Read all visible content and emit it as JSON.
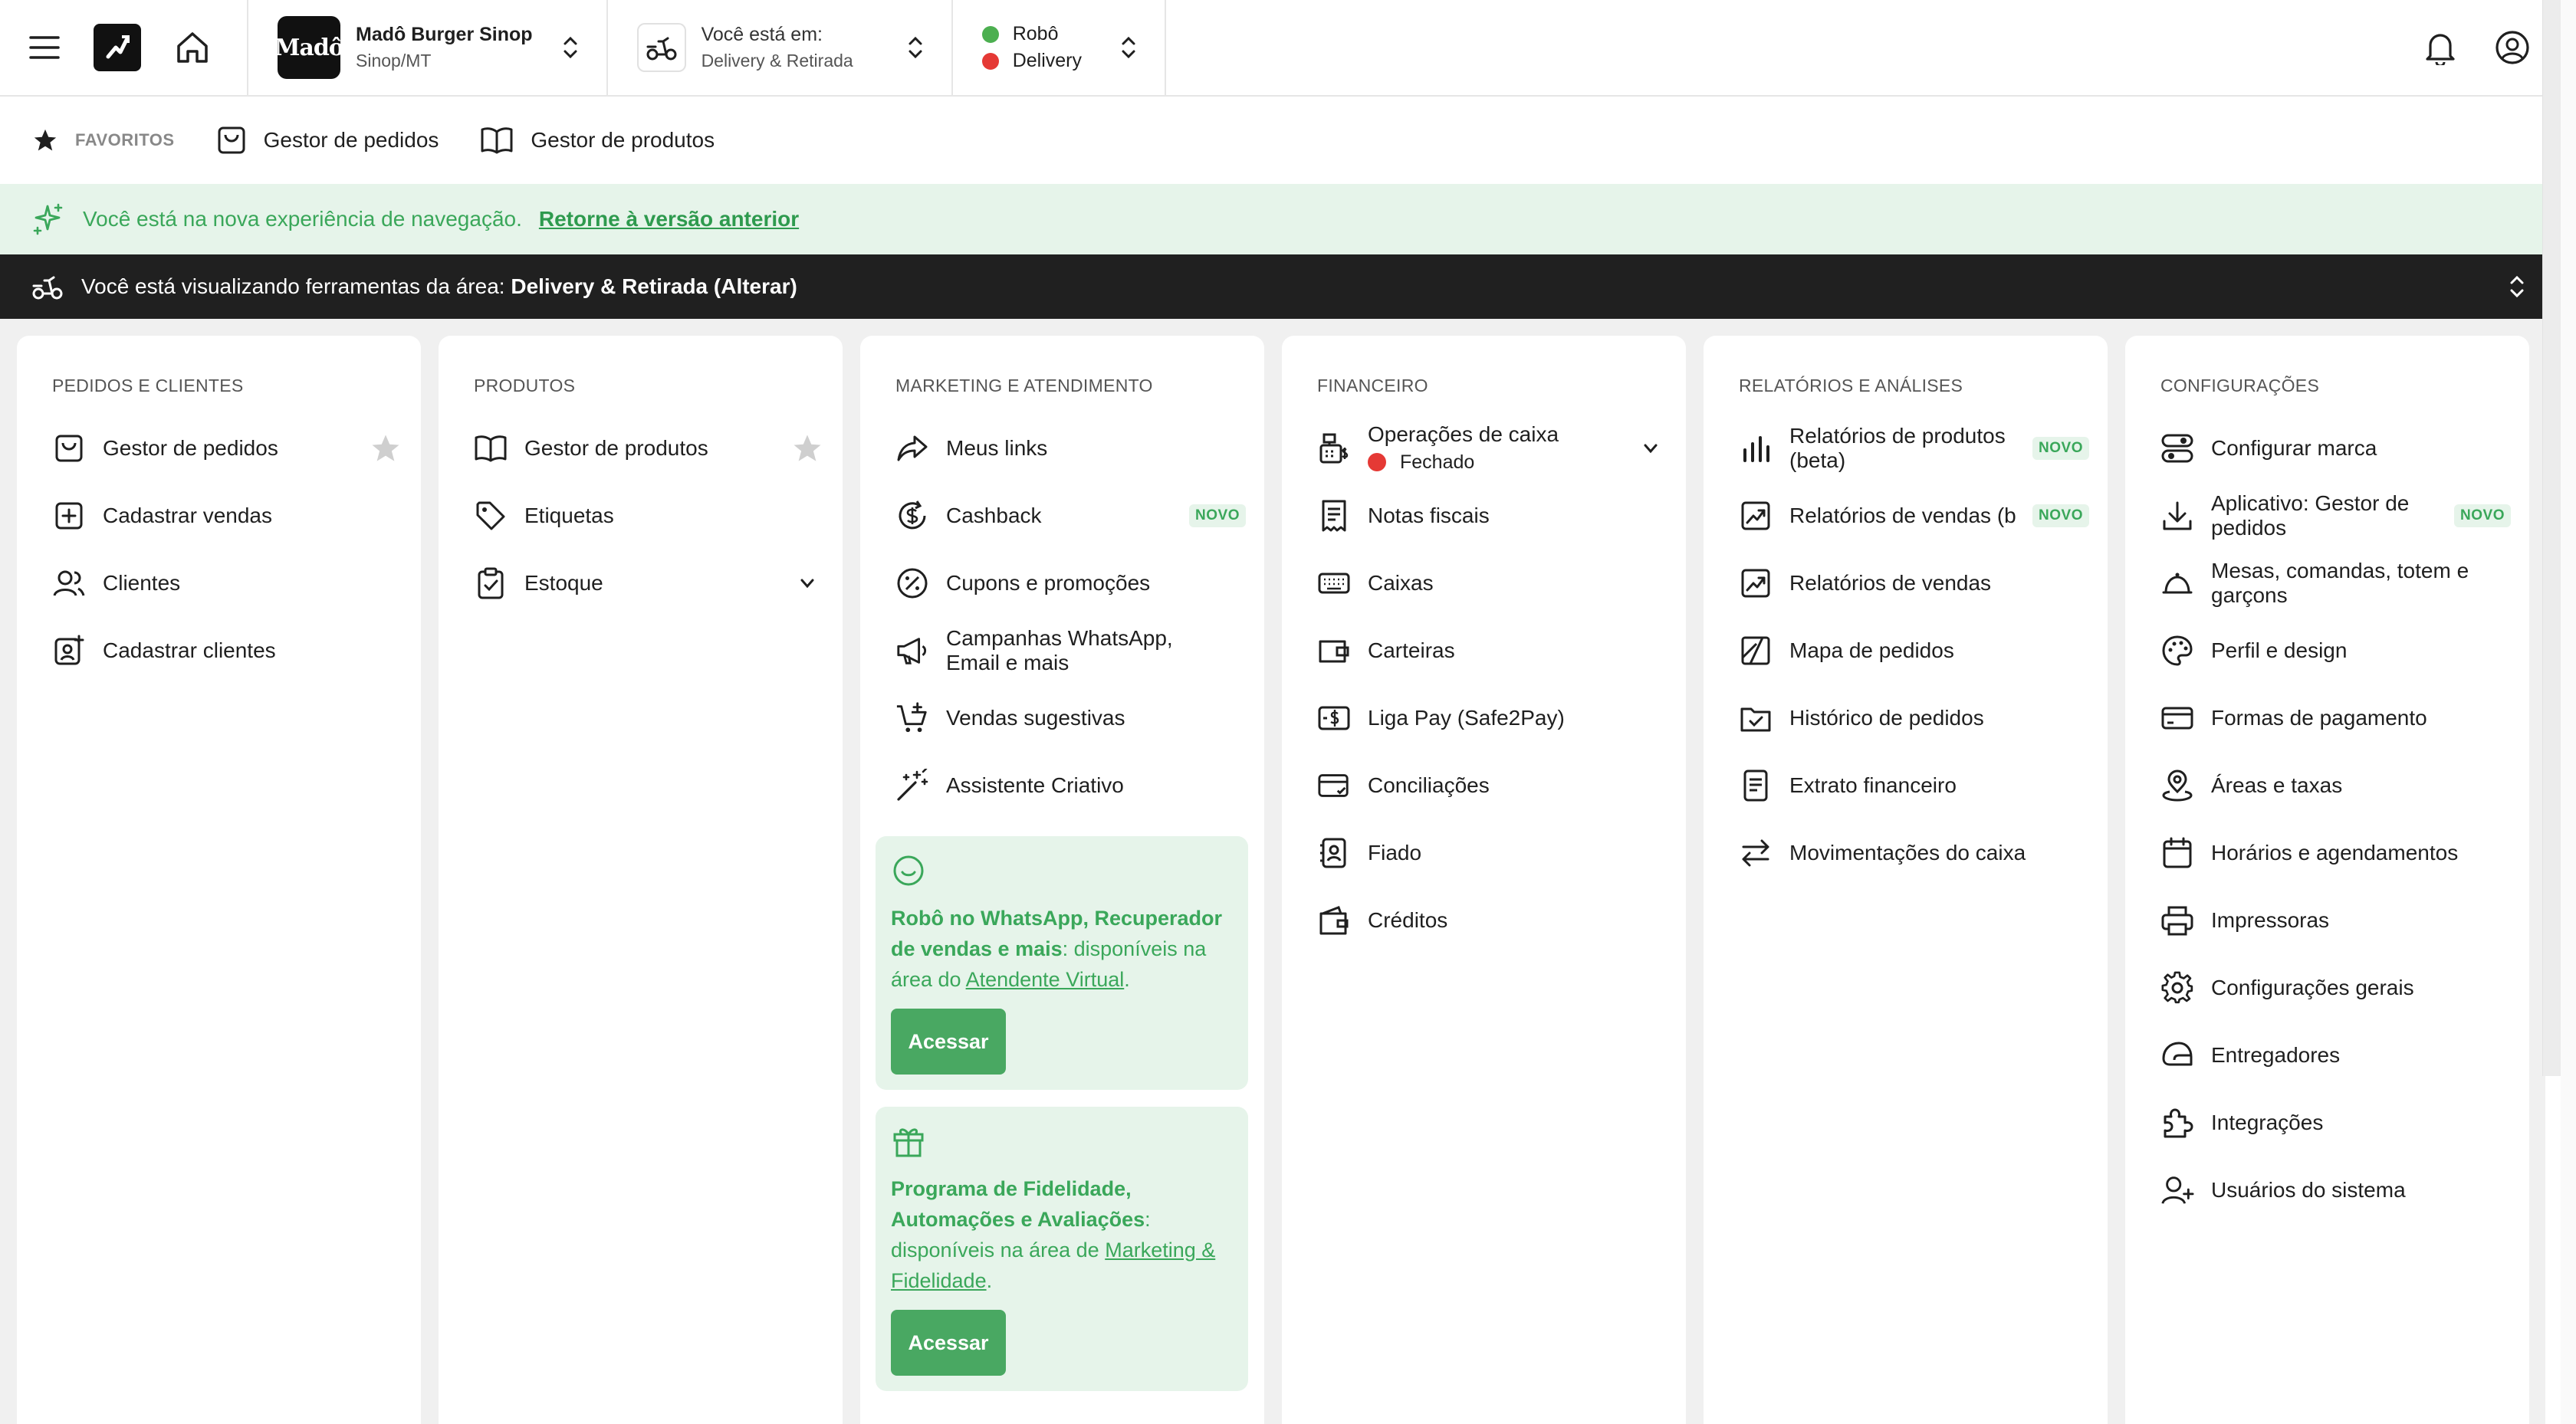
{
  "topbar": {
    "store": {
      "logo_text": "Madô",
      "name": "Madô Burger Sinop",
      "city": "Sinop/MT"
    },
    "area": {
      "label": "Você está em:",
      "value": "Delivery & Retirada"
    },
    "status": {
      "robot_label": "Robô",
      "robot_color": "#4caf50",
      "delivery_label": "Delivery",
      "delivery_color": "#e53935"
    }
  },
  "favorites": {
    "label": "FAVORITOS",
    "items": [
      "Gestor de pedidos",
      "Gestor de produtos"
    ]
  },
  "notice": {
    "text": "Você está na nova experiência de navegação.",
    "link": "Retorne à versão anterior"
  },
  "areabar": {
    "prefix": "Você está visualizando ferramentas da área:",
    "value": "Delivery & Retirada (Alterar)"
  },
  "columns": {
    "pedidos": {
      "title": "PEDIDOS E CLIENTES",
      "items": [
        "Gestor de pedidos",
        "Cadastrar vendas",
        "Clientes",
        "Cadastrar clientes"
      ]
    },
    "produtos": {
      "title": "PRODUTOS",
      "items": [
        "Gestor de produtos",
        "Etiquetas",
        "Estoque"
      ]
    },
    "marketing": {
      "title": "MARKETING E ATENDIMENTO",
      "items": [
        "Meus links",
        "Cashback",
        "Cupons e promoções",
        "Campanhas WhatsApp, Email e mais",
        "Vendas sugestivas",
        "Assistente Criativo"
      ],
      "card1": {
        "bold": "Robô no WhatsApp, Recuperador de vendas e mais",
        "text": ": disponíveis na área do ",
        "link": "Atendente Virtual",
        "end": ".",
        "button": "Acessar"
      },
      "card2": {
        "bold": "Programa de Fidelidade, Automações e Avaliações",
        "text": ": disponíveis na área de ",
        "link": "Marketing & Fidelidade",
        "end": ".",
        "button": "Acessar"
      }
    },
    "financeiro": {
      "title": "FINANCEIRO",
      "items": [
        "Operações de caixa",
        "Notas fiscais",
        "Caixas",
        "Carteiras",
        "Liga Pay (Safe2Pay)",
        "Conciliações",
        "Fiado",
        "Créditos"
      ],
      "caixa_status": "Fechado",
      "caixa_status_color": "#e53935"
    },
    "relatorios": {
      "title": "RELATÓRIOS E ANÁLISES",
      "items": [
        "Relatórios de produtos (beta)",
        "Relatórios de vendas (beta)",
        "Relatórios de vendas",
        "Mapa de pedidos",
        "Histórico de pedidos",
        "Extrato financeiro",
        "Movimentações do caixa"
      ]
    },
    "config": {
      "title": "CONFIGURAÇÕES",
      "items": [
        "Configurar marca",
        "Aplicativo: Gestor de pedidos",
        "Mesas, comandas, totem e garçons",
        "Perfil e design",
        "Formas de pagamento",
        "Áreas e taxas",
        "Horários e agendamentos",
        "Impressoras",
        "Configurações gerais",
        "Entregadores",
        "Integrações",
        "Usuários do sistema"
      ]
    }
  },
  "badge_new": "NOVO",
  "colors": {
    "accent": "#49a862",
    "notice_bg": "#e6f4ea",
    "area_bg": "#202020"
  }
}
